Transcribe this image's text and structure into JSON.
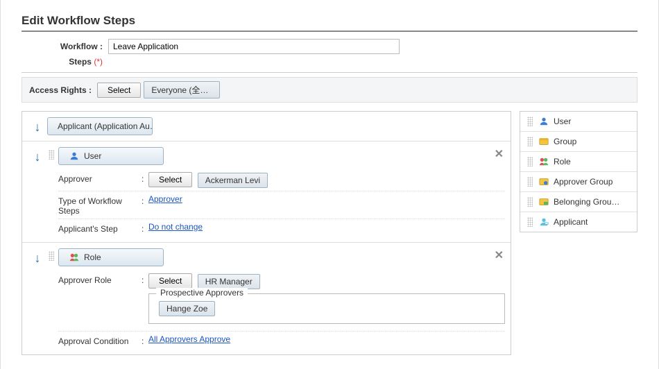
{
  "title": "Edit Workflow Steps",
  "form": {
    "workflow_label": "Workflow :",
    "workflow_value": "Leave Application",
    "steps_label": "Steps",
    "steps_required": "(*)"
  },
  "access": {
    "label": "Access Rights :",
    "select_label": "Select",
    "chip": "Everyone (全ユー…"
  },
  "steps": {
    "applicant": {
      "header": "Applicant (Application Au…"
    },
    "user": {
      "header": "User",
      "approver_label": "Approver",
      "select_label": "Select",
      "approver_chip": "Ackerman Levi",
      "type_label": "Type of Workflow Steps",
      "type_link": "Approver",
      "appstep_label": "Applicant's Step",
      "appstep_link": "Do not change"
    },
    "role": {
      "header": "Role",
      "approver_role_label": "Approver Role",
      "select_label": "Select",
      "role_chip": "HR Manager",
      "prospective_legend": "Prospective Approvers",
      "prospective_chip": "Hange Zoe",
      "cond_label": "Approval Condition",
      "cond_link": "All Approvers Approve"
    }
  },
  "palette": {
    "items": [
      {
        "label": "User",
        "icon": "user"
      },
      {
        "label": "Group",
        "icon": "group"
      },
      {
        "label": "Role",
        "icon": "role"
      },
      {
        "label": "Approver Group",
        "icon": "approver-group"
      },
      {
        "label": "Belonging Grou…",
        "icon": "belonging-group"
      },
      {
        "label": "Applicant",
        "icon": "applicant"
      }
    ]
  }
}
